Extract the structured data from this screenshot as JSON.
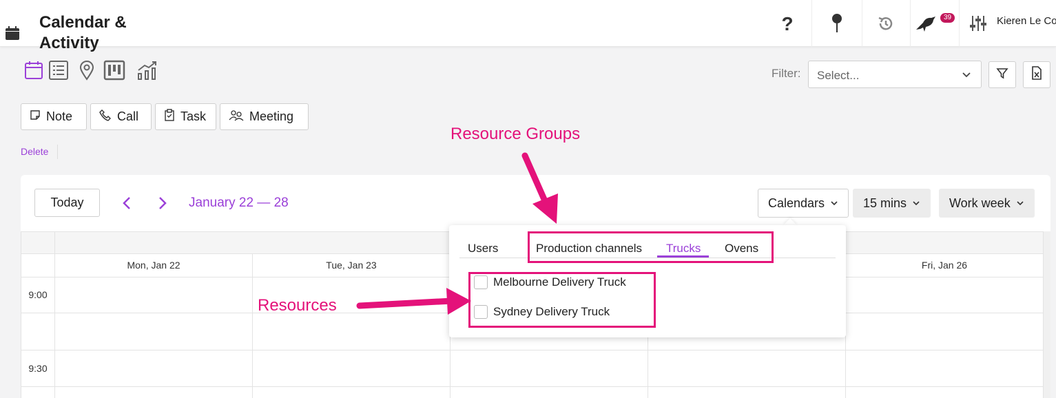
{
  "header": {
    "title": "Calendar & Activity",
    "notification_count": "39",
    "user_name": "Kieren Le Co"
  },
  "views": [
    "calendar-icon",
    "list-icon",
    "map-pin-icon",
    "kanban-icon",
    "chart-icon"
  ],
  "filter": {
    "label": "Filter:",
    "placeholder": "Select..."
  },
  "activity_buttons": {
    "note": "Note",
    "call": "Call",
    "task": "Task",
    "meeting": "Meeting"
  },
  "delete_label": "Delete",
  "toolbar": {
    "today": "Today",
    "date_range": "January 22 — 28",
    "calendars": "Calendars",
    "interval": "15 mins",
    "view_mode": "Work week"
  },
  "days": [
    "Mon, Jan 22",
    "Tue, Jan 23",
    "Fri, Jan 26"
  ],
  "times": [
    "9:00",
    "9:30"
  ],
  "popover": {
    "tabs": [
      "Users",
      "Production channels",
      "Trucks",
      "Ovens"
    ],
    "active_tab": "Trucks",
    "resources": [
      "Melbourne Delivery Truck",
      "Sydney Delivery Truck"
    ]
  },
  "annotations": {
    "resource_groups": "Resource Groups",
    "resources": "Resources"
  },
  "colors": {
    "accent": "#9b40d8",
    "annotation": "#e4127a",
    "badge": "#c2185b"
  }
}
